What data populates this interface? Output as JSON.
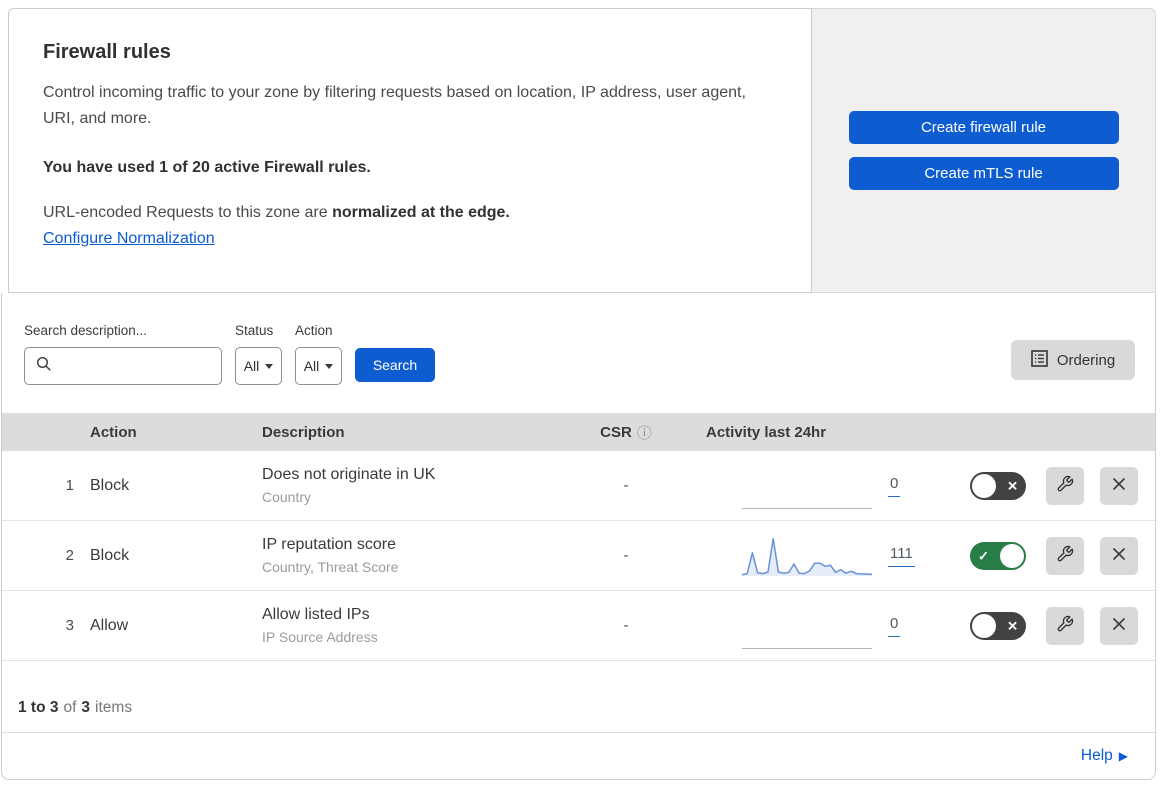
{
  "intro": {
    "title": "Firewall rules",
    "description": "Control incoming traffic to your zone by filtering requests based on location, IP address, user agent, URI, and more.",
    "usage_note": "You have used 1 of 20 active Firewall rules.",
    "normalization_prefix": "URL-encoded Requests to this zone are ",
    "normalization_bold": "normalized at the edge.",
    "normalization_link": "Configure Normalization"
  },
  "side_panel": {
    "create_firewall_rule_label": "Create firewall rule",
    "create_mtls_rule_label": "Create mTLS rule"
  },
  "filters": {
    "search_label": "Search description...",
    "search_value": "",
    "status_label": "Status",
    "status_value": "All",
    "action_label": "Action",
    "action_value": "All",
    "search_button_label": "Search",
    "ordering_button_label": "Ordering"
  },
  "table": {
    "columns": {
      "action": "Action",
      "description": "Description",
      "csr": "CSR",
      "activity": "Activity last 24hr"
    },
    "rows": [
      {
        "priority": "1",
        "action": "Block",
        "description": "Does not originate in UK",
        "criteria": "Country",
        "csr": "-",
        "activity_count": "0",
        "enabled": false,
        "sparkline": null
      },
      {
        "priority": "2",
        "action": "Block",
        "description": "IP reputation score",
        "criteria": "Country, Threat Score",
        "csr": "-",
        "activity_count": "111",
        "enabled": true,
        "sparkline": [
          3,
          6,
          58,
          8,
          6,
          10,
          93,
          10,
          7,
          9,
          30,
          7,
          6,
          13,
          32,
          32,
          24,
          27,
          9,
          16,
          7,
          12,
          6,
          5,
          5,
          4
        ]
      },
      {
        "priority": "3",
        "action": "Allow",
        "description": "Allow listed IPs",
        "criteria": "IP Source Address",
        "csr": "-",
        "activity_count": "0",
        "enabled": false,
        "sparkline": null
      }
    ]
  },
  "pagination": {
    "range_bold": "1 to 3",
    "of_text": "of",
    "total_bold": "3",
    "items_text": "items"
  },
  "help": {
    "label": "Help"
  },
  "icons": {
    "info": "ⓘ",
    "check": "✓",
    "cross": "✕",
    "help_arrow": "▶"
  },
  "colors": {
    "primary_blue": "#0d5dd1",
    "link_blue": "#0b5bd3",
    "toggle_on_green": "#287d46",
    "toggle_off_gray": "#424242",
    "sparkline_blue": "#6591d6",
    "table_header_gray": "#dcdcdc",
    "panel_gray": "#f0f0f0",
    "button_gray": "#d9d9d9"
  }
}
